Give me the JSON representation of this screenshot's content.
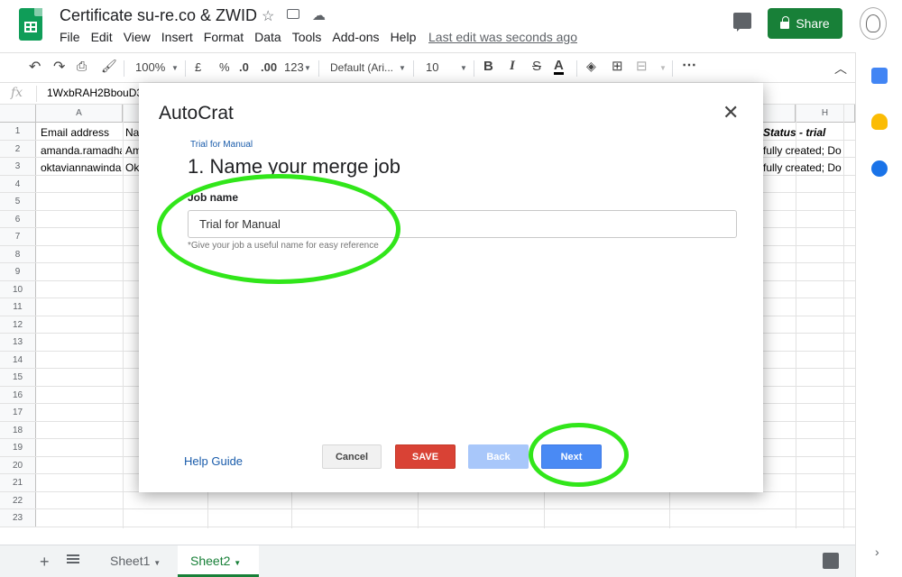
{
  "header": {
    "doc_title": "Certificate su-re.co & ZWID",
    "menu": [
      "File",
      "Edit",
      "View",
      "Insert",
      "Format",
      "Data",
      "Tools",
      "Add-ons",
      "Help"
    ],
    "last_edit": "Last edit was seconds ago",
    "share_label": "Share"
  },
  "toolbar": {
    "zoom": "100%",
    "currency": "£",
    "percent": "%",
    "decimal_decrease": ".0",
    "decimal_increase": ".00",
    "format_more": "123",
    "font": "Default (Ari...",
    "font_size": "10",
    "bold": "B",
    "italic": "I",
    "strikethrough": "S",
    "text_color": "A",
    "more": "⋯"
  },
  "formula_bar": {
    "fx": "fx",
    "content": "1WxbRAH2BbouD3"
  },
  "grid": {
    "columns": [
      "A",
      "H"
    ],
    "rows": [
      "1",
      "2",
      "3",
      "4",
      "5",
      "6",
      "7",
      "8",
      "9",
      "10",
      "11",
      "12",
      "13",
      "14",
      "15",
      "16",
      "17",
      "18",
      "19",
      "20",
      "21",
      "22",
      "23"
    ],
    "cells": {
      "a1": "Email address",
      "a2": "amanda.ramadha",
      "a3": "oktaviannawinda",
      "b1": "Na",
      "b2": "Am",
      "b3": "Ok",
      "g1": "Status - trial",
      "g2": "fully created; Do",
      "g3": "fully created; Do"
    }
  },
  "sheets": {
    "tabs": [
      "Sheet1",
      "Sheet2"
    ],
    "active": "Sheet2"
  },
  "dialog": {
    "title": "AutoCrat",
    "breadcrumb": "Trial for Manual",
    "step_heading": "1. Name your merge job",
    "job_label": "Job name",
    "job_value": "Trial for Manual",
    "job_hint": "*Give your job a useful name for easy reference",
    "help_link": "Help Guide",
    "buttons": {
      "cancel": "Cancel",
      "save": "SAVE",
      "back": "Back",
      "next": "Next"
    }
  },
  "colors": {
    "sheets_green": "#188038",
    "annotation": "#31e61a",
    "save": "#d94235",
    "next": "#4a8af4",
    "back_disabled": "#a8c7fa"
  }
}
